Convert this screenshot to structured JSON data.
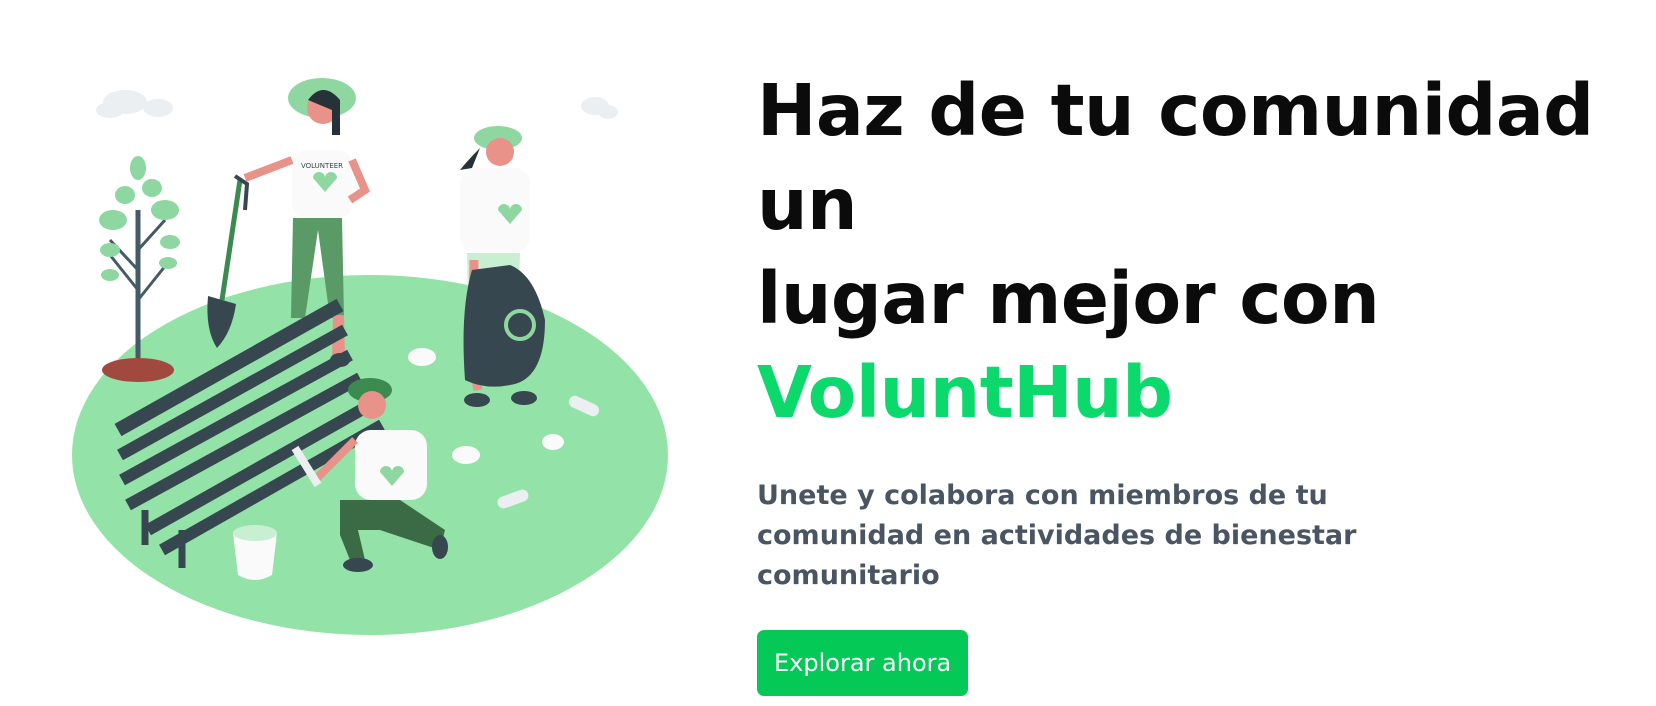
{
  "hero": {
    "title_line1": "Haz de tu comunidad un",
    "title_line2": "lugar mejor con",
    "brand": "VoluntHub",
    "subtitle": "Unete y colabora con miembros de tu comunidad en actividades de bienestar comunitario",
    "cta_label": "Explorar ahora",
    "shirt_text": "VOLUNTEER"
  },
  "colors": {
    "brand": "#0bd96b",
    "button": "#04c957",
    "ground": "#93e3a8",
    "dark": "#37474f"
  }
}
